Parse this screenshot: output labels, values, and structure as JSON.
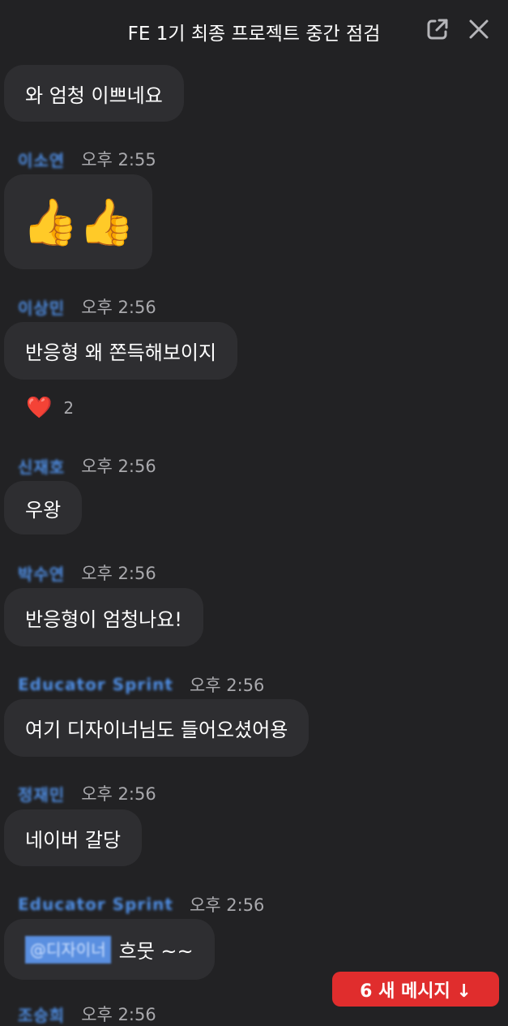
{
  "header": {
    "title": "FE 1기 최종 프로젝트 중간 점검",
    "popout_icon": "external-link-icon",
    "close_icon": "close-icon"
  },
  "messages": [
    {
      "sender": "",
      "time": "",
      "text": "와 엄청 이쁘네요"
    },
    {
      "sender": "이소연",
      "time": "오후 2:55",
      "text": "👍👍"
    },
    {
      "sender": "이상민",
      "time": "오후 2:56",
      "text": "반응형 왜 쫀득해보이지",
      "reaction": {
        "emoji": "❤️",
        "count": "2"
      }
    },
    {
      "sender": "신재호",
      "time": "오후 2:56",
      "text": "우왕"
    },
    {
      "sender": "박수연",
      "time": "오후 2:56",
      "text": "반응형이 엄청나요!"
    },
    {
      "sender": "Educator Sprint",
      "time": "오후 2:56",
      "text": "여기 디자이너님도 들어오셨어용"
    },
    {
      "sender": "정재민",
      "time": "오후 2:56",
      "text": "네이버 갈당"
    },
    {
      "sender": "Educator Sprint",
      "time": "오후 2:56",
      "mention": "@디자이너",
      "text": "흐뭇 ~~"
    },
    {
      "sender": "조승희",
      "time": "오후 2:56",
      "text": ""
    }
  ],
  "new_messages_button": "6 새 메시지 ↓",
  "colors": {
    "background": "#222224",
    "bubble": "#2e2e31",
    "sender": "#4f8fe6",
    "time": "#a9a9ad",
    "new_messages": "#e02d2d"
  }
}
